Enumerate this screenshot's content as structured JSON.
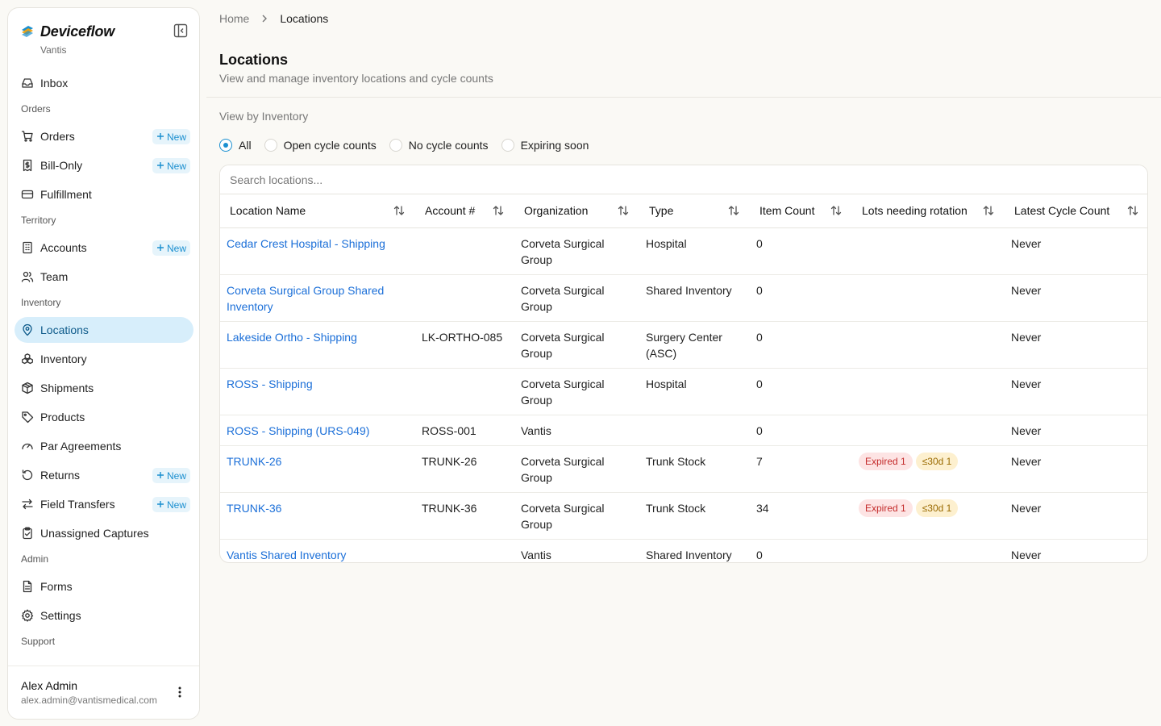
{
  "app": {
    "name": "Deviceflow",
    "org": "Vantis"
  },
  "sidebar": {
    "items": [
      {
        "id": "inbox",
        "label": "Inbox",
        "icon": "inbox-icon"
      },
      {
        "section": "Orders"
      },
      {
        "id": "orders",
        "label": "Orders",
        "icon": "cart-icon",
        "badge": "New"
      },
      {
        "id": "bill-only",
        "label": "Bill-Only",
        "icon": "receipt-icon",
        "badge": "New"
      },
      {
        "id": "fulfillment",
        "label": "Fulfillment",
        "icon": "truck-icon"
      },
      {
        "section": "Territory"
      },
      {
        "id": "accounts",
        "label": "Accounts",
        "icon": "building-icon",
        "badge": "New"
      },
      {
        "id": "team",
        "label": "Team",
        "icon": "users-icon"
      },
      {
        "section": "Inventory"
      },
      {
        "id": "locations",
        "label": "Locations",
        "icon": "map-pin-icon",
        "active": true
      },
      {
        "id": "inventory",
        "label": "Inventory",
        "icon": "boxes-icon"
      },
      {
        "id": "shipments",
        "label": "Shipments",
        "icon": "package-icon"
      },
      {
        "id": "products",
        "label": "Products",
        "icon": "tag-icon"
      },
      {
        "id": "par-agreements",
        "label": "Par Agreements",
        "icon": "gauge-icon"
      },
      {
        "id": "returns",
        "label": "Returns",
        "icon": "rotate-ccw-icon",
        "badge": "New"
      },
      {
        "id": "field-transfers",
        "label": "Field Transfers",
        "icon": "arrows-transfer-icon",
        "badge": "New"
      },
      {
        "id": "unassigned-captures",
        "label": "Unassigned Captures",
        "icon": "clipboard-check-icon"
      },
      {
        "section": "Admin"
      },
      {
        "id": "forms",
        "label": "Forms",
        "icon": "file-text-icon"
      },
      {
        "id": "settings",
        "label": "Settings",
        "icon": "gear-icon"
      },
      {
        "section": "Support"
      }
    ],
    "user": {
      "name": "Alex Admin",
      "email": "alex.admin@vantismedical.com"
    }
  },
  "breadcrumb": {
    "home": "Home",
    "current": "Locations"
  },
  "page": {
    "title": "Locations",
    "subtitle": "View and manage inventory locations and cycle counts",
    "view_label": "View by Inventory"
  },
  "filters": {
    "options": [
      "All",
      "Open cycle counts",
      "No cycle counts",
      "Expiring soon"
    ],
    "selected": "All"
  },
  "search": {
    "placeholder": "Search locations..."
  },
  "table": {
    "columns": [
      "Location Name",
      "Account #",
      "Organization",
      "Type",
      "Item Count",
      "Lots needing rotation",
      "Latest Cycle Count"
    ],
    "rows": [
      {
        "name": "Cedar Crest Hospital - Shipping",
        "account": "",
        "org": "Corveta Surgical Group",
        "type": "Hospital",
        "count": "0",
        "badges": [],
        "latest": "Never"
      },
      {
        "name": "Corveta Surgical Group Shared Inventory",
        "account": "",
        "org": "Corveta Surgical Group",
        "type": "Shared Inventory",
        "count": "0",
        "badges": [],
        "latest": "Never"
      },
      {
        "name": "Lakeside Ortho - Shipping",
        "account": "LK-ORTHO-085",
        "org": "Corveta Surgical Group",
        "type": "Surgery Center (ASC)",
        "count": "0",
        "badges": [],
        "latest": "Never"
      },
      {
        "name": "ROSS - Shipping",
        "account": "",
        "org": "Corveta Surgical Group",
        "type": "Hospital",
        "count": "0",
        "badges": [],
        "latest": "Never"
      },
      {
        "name": "ROSS - Shipping (URS-049)",
        "account": "ROSS-001",
        "org": "Vantis",
        "type": "",
        "count": "0",
        "badges": [],
        "latest": "Never"
      },
      {
        "name": "TRUNK-26",
        "account": "TRUNK-26",
        "org": "Corveta Surgical Group",
        "type": "Trunk Stock",
        "count": "7",
        "badges": [
          {
            "kind": "expired",
            "text": "Expired 1"
          },
          {
            "kind": "soon",
            "text": "≤30d 1"
          }
        ],
        "latest": "Never"
      },
      {
        "name": "TRUNK-36",
        "account": "TRUNK-36",
        "org": "Corveta Surgical Group",
        "type": "Trunk Stock",
        "count": "34",
        "badges": [
          {
            "kind": "expired",
            "text": "Expired 1"
          },
          {
            "kind": "soon",
            "text": "≤30d 1"
          }
        ],
        "latest": "Never"
      },
      {
        "name": "Vantis Shared Inventory",
        "account": "",
        "org": "Vantis",
        "type": "Shared Inventory",
        "count": "0",
        "badges": [],
        "latest": "Never"
      }
    ]
  },
  "colors": {
    "accent": "#1a8fd0",
    "link": "#1b6fd8",
    "active_bg": "#d7eefb",
    "expired": "#c42b2b",
    "soon": "#9a6a00"
  }
}
